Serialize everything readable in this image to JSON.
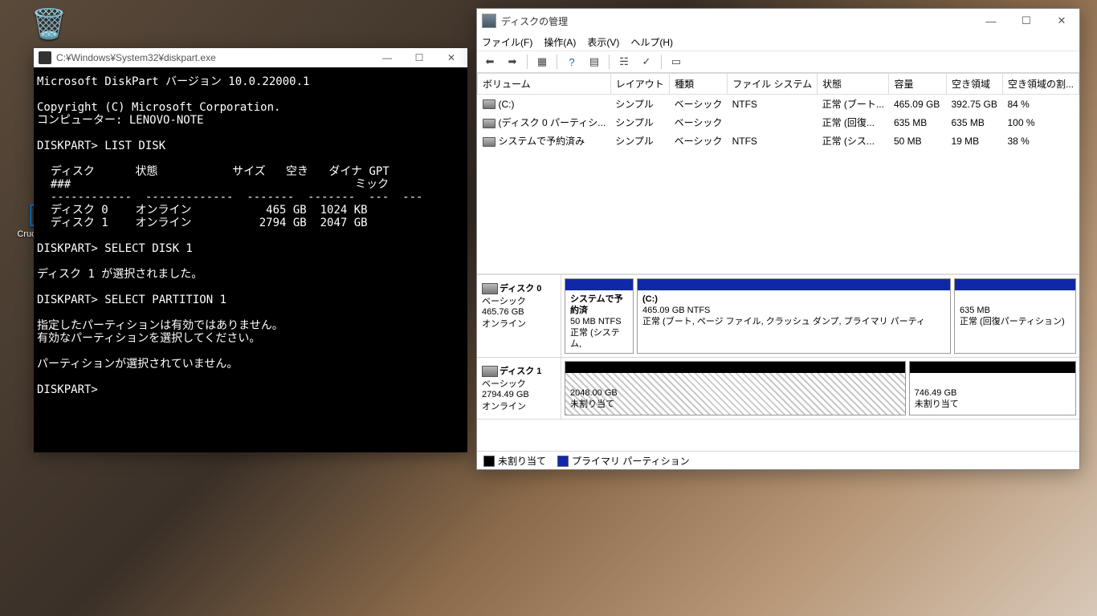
{
  "desktop": {
    "recycle_bin": "",
    "crucial_icon_label": "Crucial Ex..."
  },
  "console": {
    "title": "C:¥Windows¥System32¥diskpart.exe",
    "body": "Microsoft DiskPart バージョン 10.0.22000.1\n\nCopyright (C) Microsoft Corporation.\nコンピューター: LENOVO-NOTE\n\nDISKPART> LIST DISK\n\n  ディスク      状態           サイズ   空き   ダイナ GPT\n  ###                                          ミック\n  ------------  -------------  -------  -------  ---  ---\n  ディスク 0    オンライン           465 GB  1024 KB\n  ディスク 1    オンライン          2794 GB  2047 GB\n\nDISKPART> SELECT DISK 1\n\nディスク 1 が選択されました。\n\nDISKPART> SELECT PARTITION 1\n\n指定したパーティションは有効ではありません。\n有効なパーティションを選択してください。\n\nパーティションが選択されていません。\n\nDISKPART>"
  },
  "dm": {
    "title": "ディスクの管理",
    "menu": {
      "file": "ファイル(F)",
      "action": "操作(A)",
      "view": "表示(V)",
      "help": "ヘルプ(H)"
    },
    "columns": {
      "volume": "ボリューム",
      "layout": "レイアウト",
      "type": "種類",
      "fs": "ファイル システム",
      "status": "状態",
      "capacity": "容量",
      "free": "空き領域",
      "pct": "空き領域の割..."
    },
    "rows": [
      {
        "volume": "(C:)",
        "layout": "シンプル",
        "type": "ベーシック",
        "fs": "NTFS",
        "status": "正常 (ブート...",
        "capacity": "465.09 GB",
        "free": "392.75 GB",
        "pct": "84 %"
      },
      {
        "volume": "(ディスク 0 パーティシ...",
        "layout": "シンプル",
        "type": "ベーシック",
        "fs": "",
        "status": "正常 (回復...",
        "capacity": "635 MB",
        "free": "635 MB",
        "pct": "100 %"
      },
      {
        "volume": "システムで予約済み",
        "layout": "シンプル",
        "type": "ベーシック",
        "fs": "NTFS",
        "status": "正常 (シス...",
        "capacity": "50 MB",
        "free": "19 MB",
        "pct": "38 %"
      }
    ],
    "disk0": {
      "name": "ディスク 0",
      "type": "ベーシック",
      "size": "465.76 GB",
      "status": "オンライン",
      "p1": {
        "title": "システムで予約済",
        "sub": "50 MB NTFS",
        "stat": "正常 (システム,"
      },
      "p2": {
        "title": "(C:)",
        "sub": "465.09 GB NTFS",
        "stat": "正常 (ブート, ページ ファイル, クラッシュ ダンプ, プライマリ パーティ"
      },
      "p3": {
        "title": "",
        "sub": "635 MB",
        "stat": "正常 (回復パーティション)"
      }
    },
    "disk1": {
      "name": "ディスク 1",
      "type": "ベーシック",
      "size": "2794.49 GB",
      "status": "オンライン",
      "p1": {
        "sub": "2048.00 GB",
        "stat": "未割り当て"
      },
      "p2": {
        "sub": "746.49 GB",
        "stat": "未割り当て"
      }
    },
    "legend": {
      "unalloc": "未割り当て",
      "primary": "プライマリ パーティション"
    }
  }
}
